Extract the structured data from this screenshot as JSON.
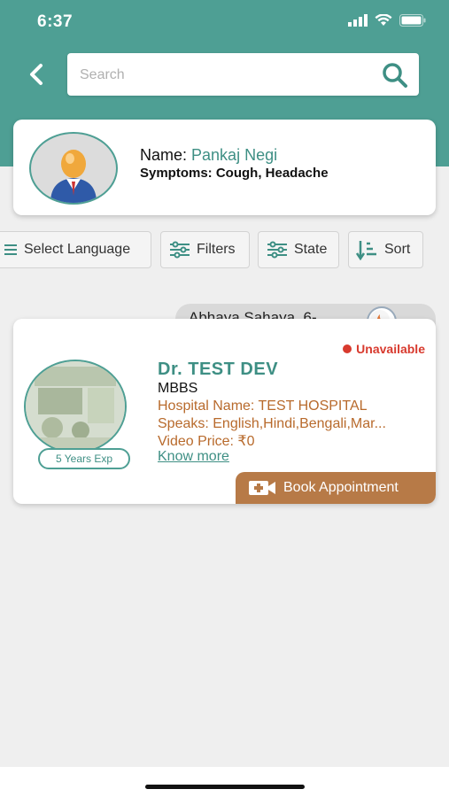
{
  "status_bar": {
    "time": "6:37"
  },
  "header": {
    "search": {
      "placeholder": "Search",
      "value": ""
    }
  },
  "patient": {
    "name_label": "Name:",
    "name": "Pankaj Negi",
    "symptoms_text": "Symptoms: Cough, Headache"
  },
  "filters": [
    {
      "label": "Select Language",
      "icon": "language-icon"
    },
    {
      "label": "Filters",
      "icon": "sliders-icon"
    },
    {
      "label": "State",
      "icon": "sliders-icon"
    },
    {
      "label": "Sort",
      "icon": "sort-icon"
    }
  ],
  "doctor_card": {
    "clinic": "Abhaya Sahaya, 6-...",
    "availability": "Unavailable",
    "name": "Dr. TEST DEV",
    "degree": "MBBS",
    "hospital": "Hospital Name: TEST HOSPITAL",
    "languages": "Speaks: English,Hindi,Bengali,Mar...",
    "price": "Video Price: ₹0",
    "know_more": "Know more",
    "experience": "5 Years Exp",
    "book_label": "Book Appointment"
  },
  "colors": {
    "primary": "#4e9f94",
    "accent": "#b77a47",
    "status_red": "#d83a2e",
    "info_text": "#b86a2c"
  }
}
